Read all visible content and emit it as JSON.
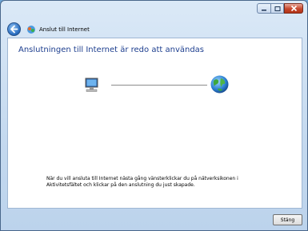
{
  "window": {
    "title": "Anslut till Internet",
    "controls": [
      "minimize-icon",
      "maximize-icon",
      "close-icon"
    ]
  },
  "nav": {
    "back_icon": "back-arrow-icon"
  },
  "main": {
    "heading": "Anslutningen till Internet är redo att användas",
    "left_icon": "computer-icon",
    "right_icon": "globe-icon",
    "info_text": "När du vill ansluta till Internet nästa gång vänsterklickar du på nätverksikonen i Aktivitetsfältet och klickar på den anslutning du just skapade."
  },
  "footer": {
    "close_label": "Stäng"
  },
  "colors": {
    "heading": "#1e3f8f",
    "frame": "#c4d9ef",
    "close": "#c7462c"
  }
}
